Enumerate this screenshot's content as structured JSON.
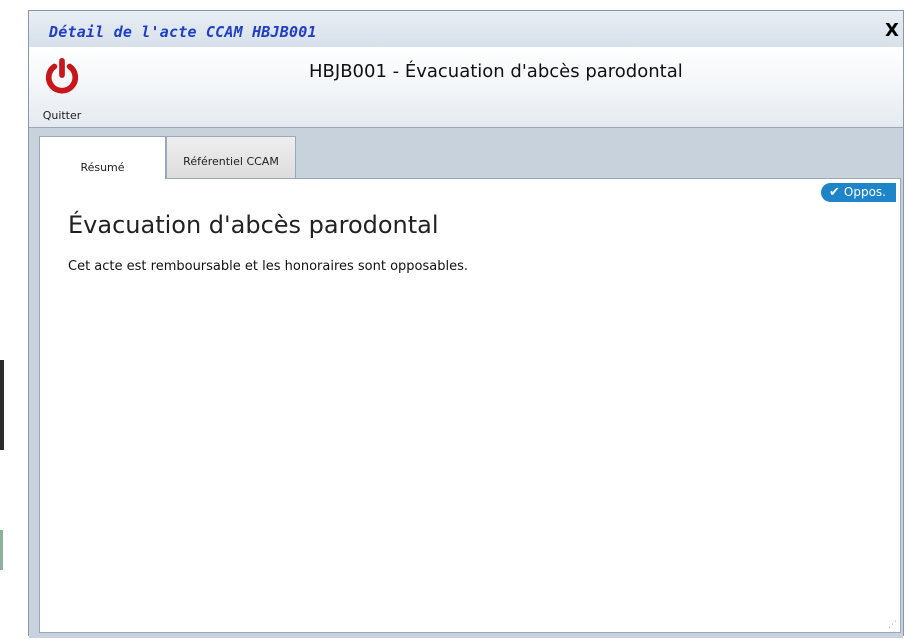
{
  "window": {
    "title": "Détail de l'acte CCAM HBJB001",
    "close_label": "X"
  },
  "header": {
    "quit_label": "Quitter",
    "title": "HBJB001 - Évacuation d'abcès parodontal",
    "quit_icon": "power-icon"
  },
  "tabs": [
    {
      "label": "Résumé",
      "active": true
    },
    {
      "label": "Référentiel CCAM",
      "active": false
    }
  ],
  "content": {
    "badge_label": "Oppos.",
    "badge_icon": "check-icon",
    "badge_color": "#1e86c8",
    "act_title": "Évacuation d'abcès parodontal",
    "act_description": "Cet acte est remboursable et les honoraires sont opposables."
  },
  "colors": {
    "title_text": "#1f3fc4",
    "quit_icon": "#c8171b"
  }
}
